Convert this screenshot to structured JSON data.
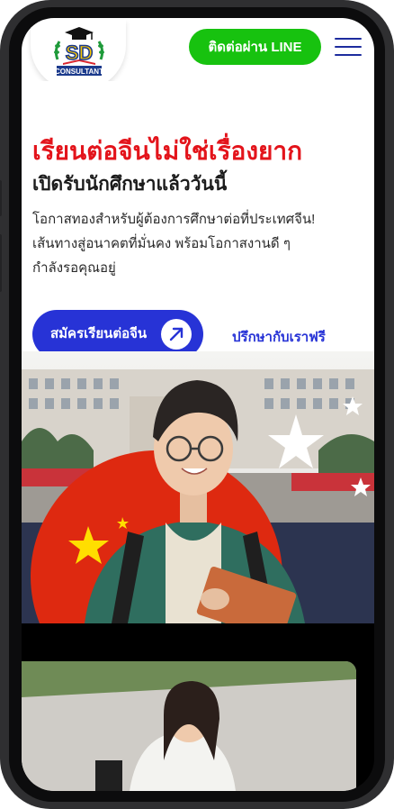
{
  "header": {
    "logo": {
      "letters": "SD",
      "text": "CONSULTANT"
    },
    "line_button": "ติดต่อผ่าน LINE",
    "menu_icon": "hamburger-menu-icon"
  },
  "hero": {
    "headline": "เรียนต่อจีนไม่ใช่เรื่องยาก",
    "subheadline": "เปิดรับนักศึกษาแล้ววันนี้",
    "description": [
      "โอกาสทองสำหรับผู้ต้องการศึกษาต่อที่ประเทศจีน!",
      "เส้นทางสู่อนาคตที่มั่นคง พร้อมโอกาสงานดี ๆ",
      "กำลังรอคุณอยู่"
    ],
    "primary_cta": "สมัครเรียนต่อจีน",
    "primary_cta_icon": "arrow-up-right-icon",
    "secondary_cta": "ปรึกษากับเราฟรี"
  },
  "colors": {
    "brand_red": "#e3141b",
    "brand_blue": "#2733d6",
    "line_green": "#17c20f",
    "menu_blue": "#1d2c9e"
  }
}
